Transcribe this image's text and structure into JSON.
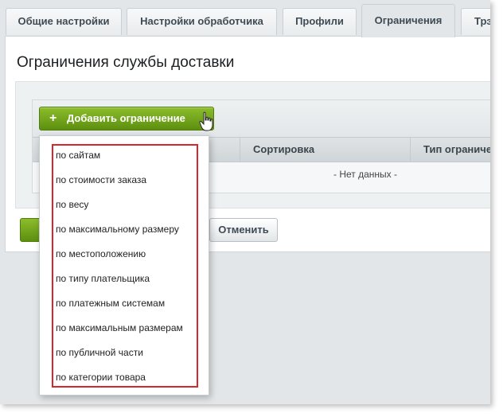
{
  "tabs": [
    {
      "label": "Общие настройки",
      "active": false
    },
    {
      "label": "Настройки обработчика",
      "active": false
    },
    {
      "label": "Профили",
      "active": false
    },
    {
      "label": "Ограничения",
      "active": true
    },
    {
      "label": "Трэ",
      "active": false
    }
  ],
  "panel": {
    "title": "Ограничения службы доставки"
  },
  "toolbar": {
    "add_label": "Добавить ограничение",
    "plus_glyph": "+"
  },
  "grid": {
    "columns": [
      "Сортировка",
      "Тип ограничен"
    ],
    "empty_text": "- Нет данных -"
  },
  "actions": {
    "cancel_label": "Отменить"
  },
  "menu": {
    "items": [
      "по сайтам",
      "по стоимости заказа",
      "по весу",
      "по максимальному размеру",
      "по местоположению",
      "по типу плательщика",
      "по платежным системам",
      "по максимальным размерам",
      "по публичной части",
      "по категории товара"
    ]
  },
  "colors": {
    "accent_green": "#6f9e16",
    "highlight_red": "#d7262e"
  }
}
